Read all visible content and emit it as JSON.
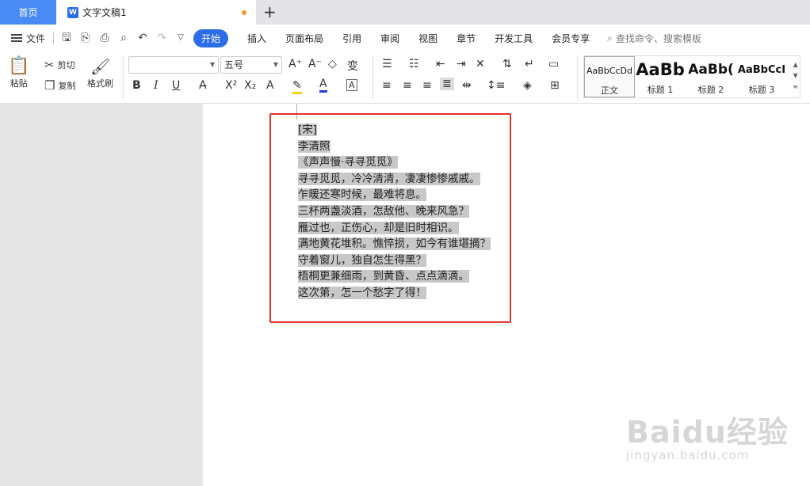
{
  "tabs": {
    "home_label": "首页",
    "doc_icon": "W",
    "doc_title": "文字文稿1",
    "add_tab": "+"
  },
  "menu": {
    "file_label": "文件",
    "items": [
      "开始",
      "插入",
      "页面布局",
      "引用",
      "审阅",
      "视图",
      "章节",
      "开发工具",
      "会员专享"
    ],
    "search_placeholder": "查找命令、搜索模板"
  },
  "ribbon": {
    "paste_label": "粘贴",
    "cut_label": "剪切",
    "copy_label": "复制",
    "format_painter_label": "格式刷",
    "font_name": "",
    "font_size": "五号",
    "styles": [
      {
        "preview": "AaBbCcDd",
        "label": "正文"
      },
      {
        "preview": "AaBb",
        "label": "标题 1"
      },
      {
        "preview": "AaBb(",
        "label": "标题 2"
      },
      {
        "preview": "AaBbCcI",
        "label": "标题 3"
      }
    ]
  },
  "document": {
    "lines": [
      "[宋]",
      "李清照",
      "《声声慢·寻寻觅觅》",
      "寻寻觅觅，冷冷清清，凄凄惨惨戚戚。",
      "乍暖还寒时候，最难将息。",
      "三杯两盏淡酒，怎敌他、晚来风急？",
      "雁过也，正伤心，却是旧时相识。",
      "满地黄花堆积。憔悴损，如今有谁堪摘？",
      "守着窗儿，独自怎生得黑？",
      "梧桐更兼细雨，到黄昏、点点滴滴。",
      "这次第，怎一个愁字了得！"
    ]
  },
  "watermark": {
    "main": "Baidu经验",
    "sub": "jingyan.baidu.com"
  },
  "colors": {
    "accent": "#2b6de8",
    "home_tab": "#4a8af4",
    "highlight_box": "#e5322d",
    "selection": "#c8c8c8"
  }
}
